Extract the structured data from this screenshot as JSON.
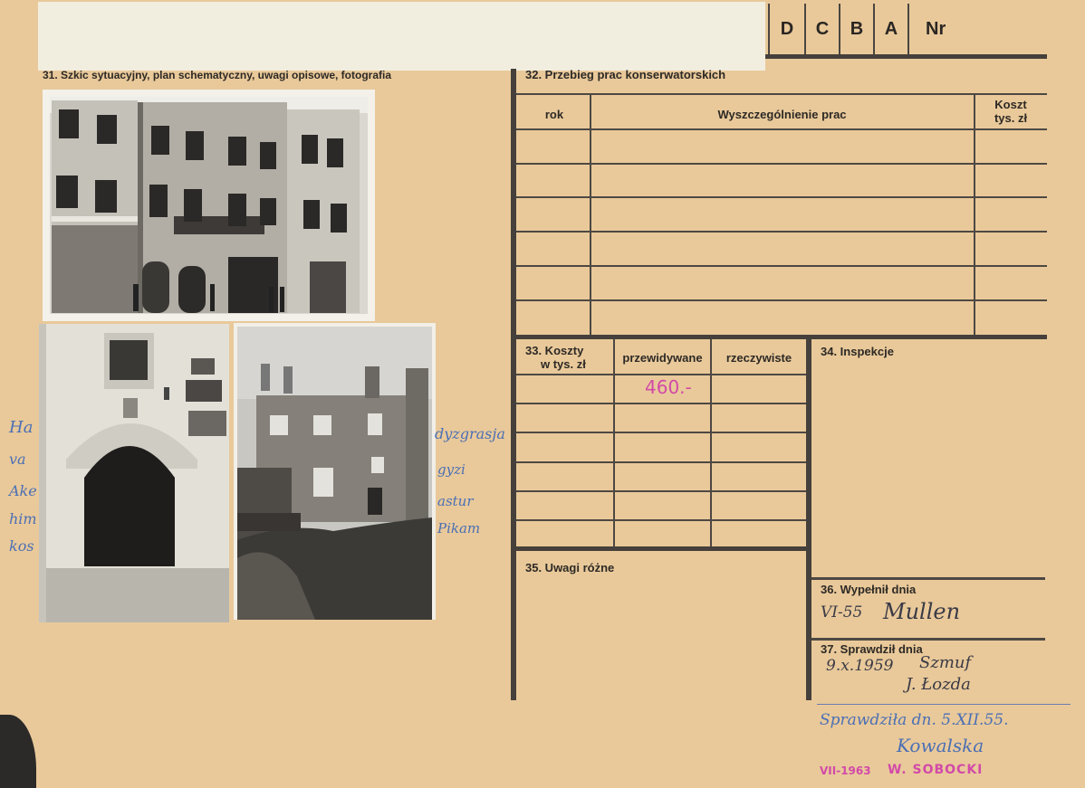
{
  "header": {
    "cols": [
      "D",
      "C",
      "B",
      "A",
      "Nr"
    ]
  },
  "section31": {
    "label": "31. Szkic sytuacyjny, plan schematyczny, uwagi opisowe, fotografia"
  },
  "section32": {
    "label": "32. Przebieg prac konserwatorskich",
    "col_rok": "rok",
    "col_desc": "Wyszczególnienie prac",
    "col_cost_line1": "Koszt",
    "col_cost_line2": "tys. zł"
  },
  "section33": {
    "label_line1": "33. Koszty",
    "label_line2": "w tys. zł",
    "col_planned": "przewidywane",
    "col_actual": "rzeczywiste",
    "planned_value": "460.-"
  },
  "section34": {
    "label": "34. Inspekcje"
  },
  "section35": {
    "label": "35. Uwagi różne"
  },
  "section36": {
    "label": "36. Wypełnił dnia",
    "date": "VI-55",
    "signature": "Mullen"
  },
  "section37": {
    "label": "37. Sprawdził dnia",
    "date": "9.x.1959",
    "signature1": "Szmuf",
    "signature2": "J. Łozda"
  },
  "annotations": {
    "note1": "Sprawdziła dn. 5.XII.55.",
    "note1_signature": "Kowalska",
    "stamp_date": "VII-1963",
    "stamp_name": "W. SOBOCKI",
    "left_margin": [
      "Ha",
      "va",
      "Ake",
      "him",
      "kos"
    ],
    "right_margin": [
      "dyzgrasja",
      "gyzi",
      "astur",
      "Pikam"
    ]
  },
  "colors": {
    "card": "#e9c99a",
    "ink_blue": "#4b6fb4",
    "ink_pink": "#d24aa8",
    "rule": "#45403b"
  }
}
